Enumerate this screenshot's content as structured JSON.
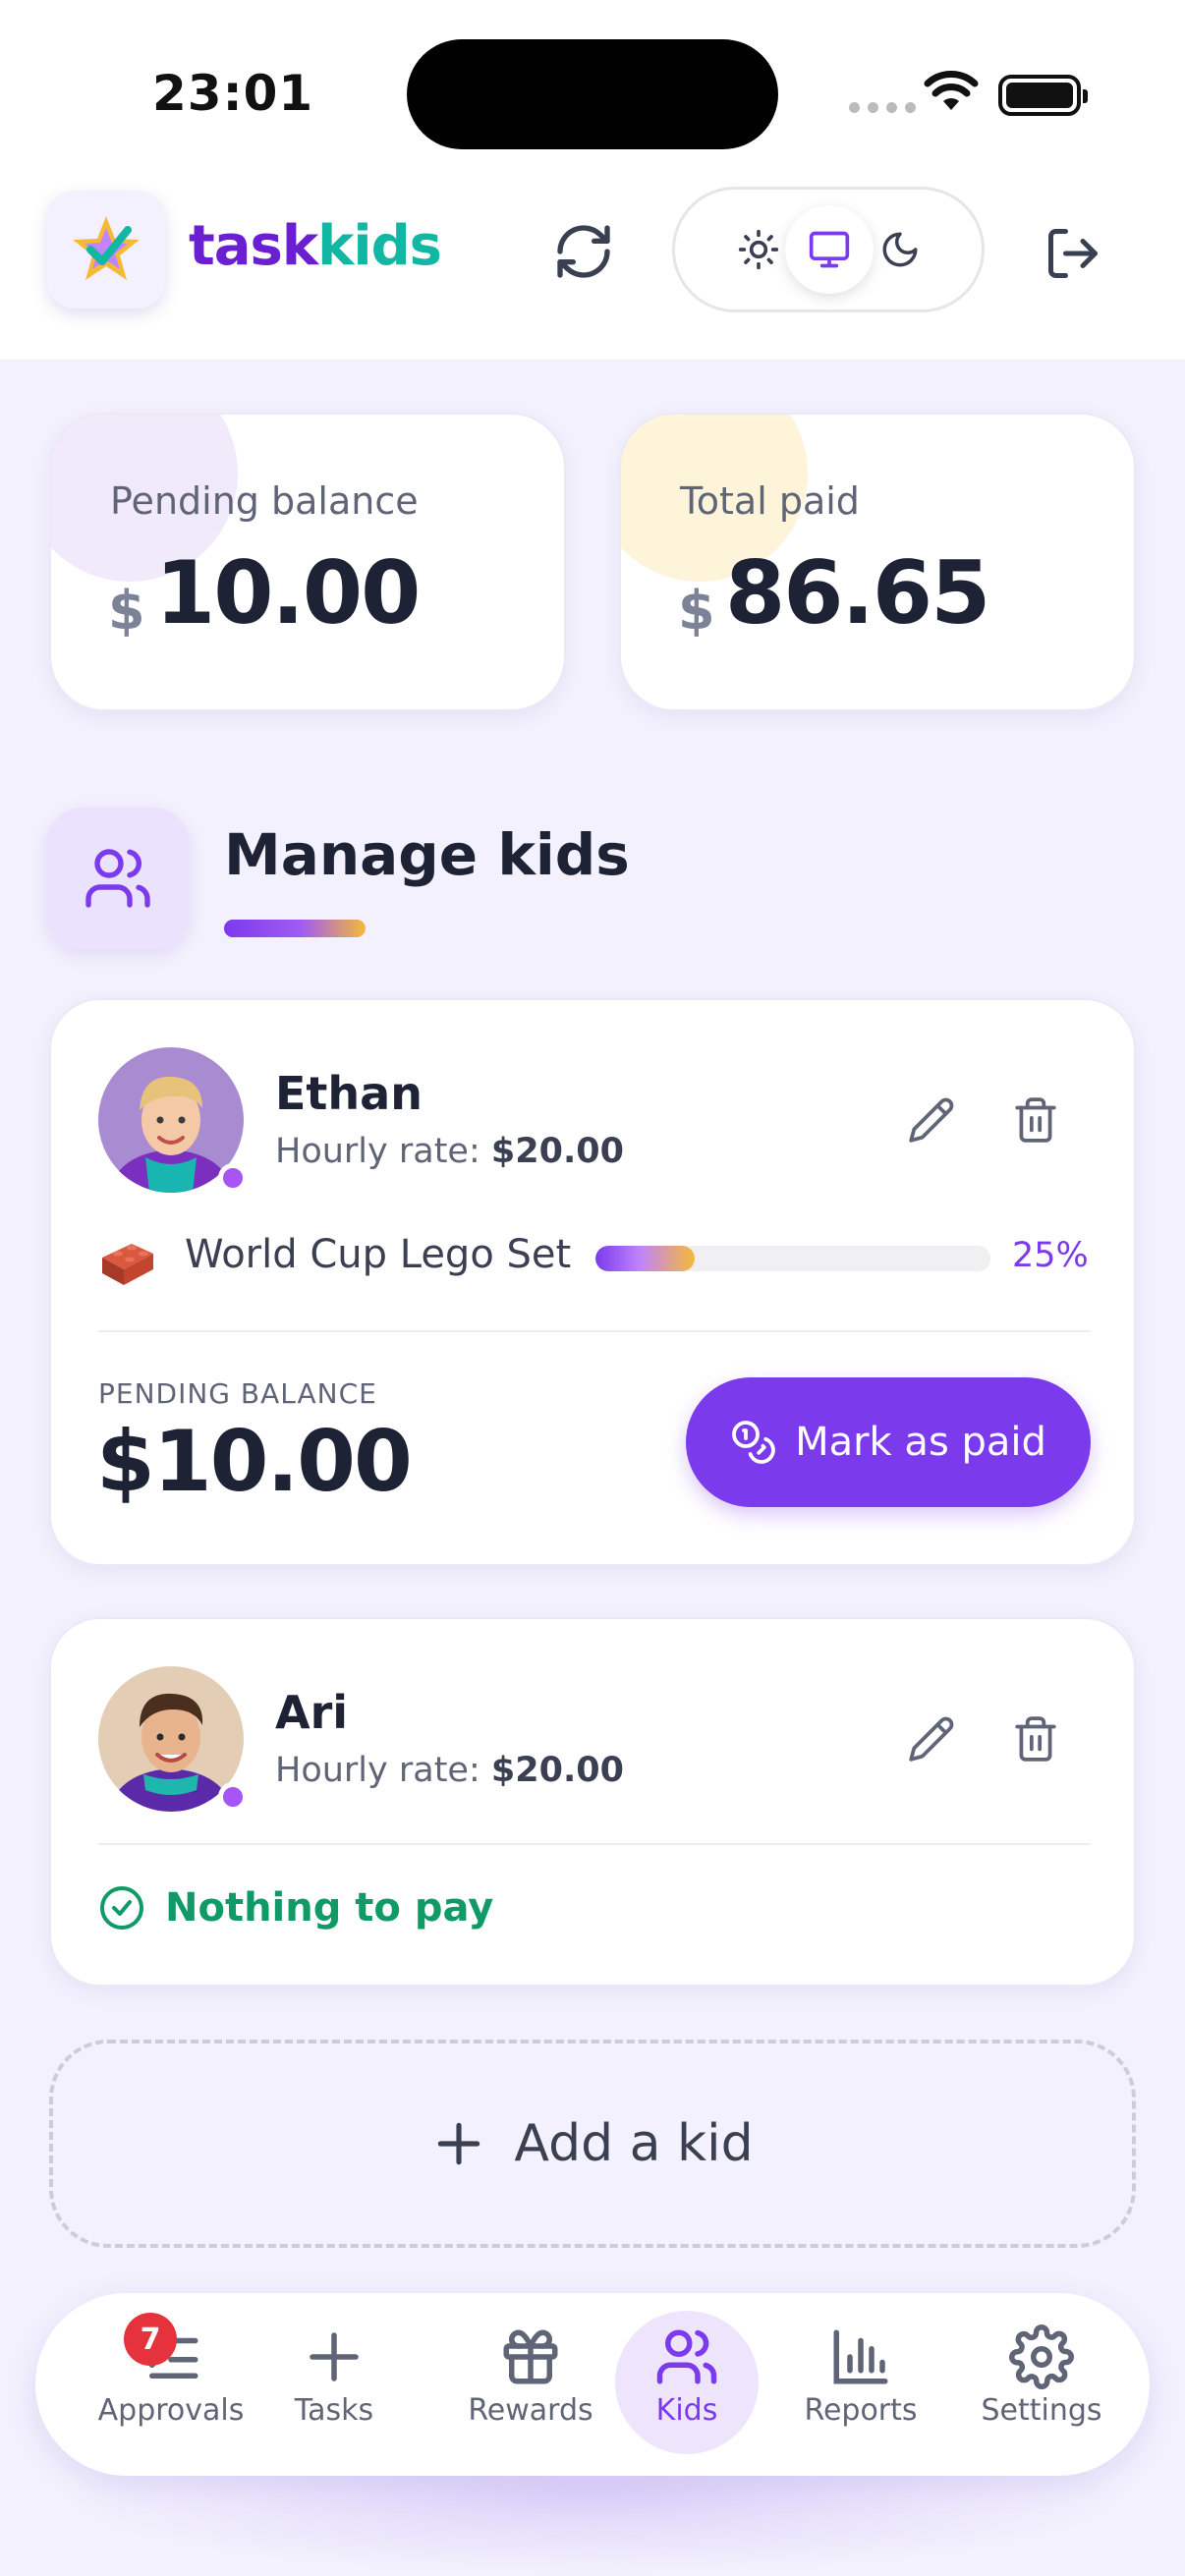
{
  "status_bar": {
    "time": "23:01"
  },
  "header": {
    "brand_part1": "task",
    "brand_part2": "ids",
    "brand_part2_prefix": "k"
  },
  "summary": {
    "pending": {
      "label": "Pending balance",
      "currency": "$",
      "amount": "10.00"
    },
    "paid": {
      "label": "Total paid",
      "currency": "$",
      "amount": "86.65"
    }
  },
  "section": {
    "title": "Manage kids"
  },
  "kids": [
    {
      "name": "Ethan",
      "rate_label": "Hourly rate:",
      "rate_value": "$20.00",
      "goal": {
        "name": "World Cup Lego Set",
        "progress_percent": 25,
        "progress_label": "25%"
      },
      "pending_label": "PENDING BALANCE",
      "pending_amount": "$10.00",
      "pay_button": "Mark as paid"
    },
    {
      "name": "Ari",
      "rate_label": "Hourly rate:",
      "rate_value": "$20.00",
      "status": "Nothing to pay"
    }
  ],
  "add_kid": "Add a kid",
  "nav": {
    "approvals": {
      "label": "Approvals",
      "badge": "7"
    },
    "tasks": {
      "label": "Tasks"
    },
    "rewards": {
      "label": "Rewards"
    },
    "kids": {
      "label": "Kids"
    },
    "reports": {
      "label": "Reports"
    },
    "settings": {
      "label": "Settings"
    }
  },
  "colors": {
    "accent": "#7c3aed",
    "teal": "#12b7a4",
    "success": "#0f9a66",
    "badge": "#e5323d"
  }
}
